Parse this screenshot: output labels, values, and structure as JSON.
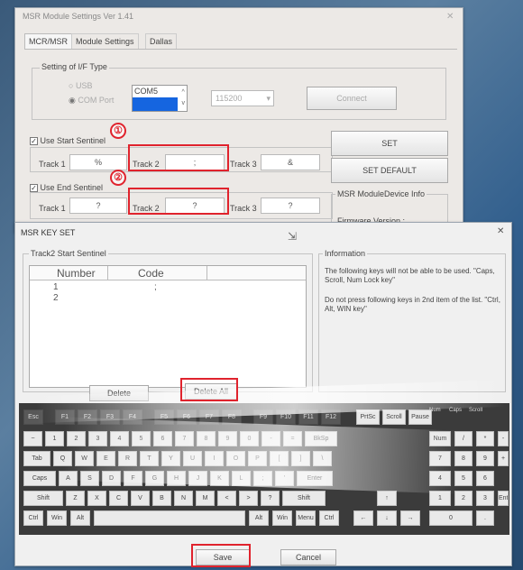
{
  "settings_window": {
    "title": "MSR Module Settings Ver 1.41",
    "tabs": [
      "MCR/MSR",
      "Module Settings",
      "Dallas"
    ],
    "if_group": {
      "title": "Setting of I/F Type",
      "radio_usb": "USB",
      "radio_com": "COM Port",
      "com_list": [
        "COM5",
        ""
      ],
      "baud": "115200",
      "connect": "Connect"
    },
    "start_sentinel": {
      "checkbox": "Use Start Sentinel",
      "track1_label": "Track 1",
      "track1_value": "%",
      "track2_label": "Track 2",
      "track2_value": ";",
      "track3_label": "Track 3",
      "track3_value": "&"
    },
    "end_sentinel": {
      "checkbox": "Use End Sentinel",
      "track1_label": "Track 1",
      "track1_value": "?",
      "track2_label": "Track 2",
      "track2_value": "?",
      "track3_label": "Track 3",
      "track3_value": "?"
    },
    "set_button": "SET",
    "set_default_button": "SET DEFAULT",
    "info_group_title": "MSR ModuleDevice Info",
    "firmware_label": "Firmware Version :"
  },
  "markers": {
    "one": "①",
    "two": "②"
  },
  "key_dialog": {
    "title": "MSR KEY SET",
    "close": "✕",
    "group_title": "Track2 Start Sentinel",
    "columns": [
      "Number",
      "Code"
    ],
    "rows": [
      {
        "number": "1",
        "code": ";"
      },
      {
        "number": "2",
        "code": ""
      }
    ],
    "info_title": "Information",
    "info_text_1": "The following keys will not be able to be used. \"Caps, Scroll, Num Lock key\"",
    "info_text_2": "Do not press following keys in 2nd item of the list. \"Ctrl, Alt, WIN key\"",
    "delete": "Delete",
    "delete_all": "Delete All",
    "save": "Save",
    "cancel": "Cancel"
  },
  "keyboard": {
    "row_fn": [
      "Esc",
      "F1",
      "F2",
      "F3",
      "F4",
      "F5",
      "F6",
      "F7",
      "F8",
      "F9",
      "F10",
      "F11",
      "F12",
      "PrtSc",
      "Scroll",
      "Pause"
    ],
    "indicators": [
      "Num",
      "Caps",
      "Scroll"
    ],
    "row_num": [
      "~",
      "1",
      "2",
      "3",
      "4",
      "5",
      "6",
      "7",
      "8",
      "9",
      "0",
      "-",
      "=",
      "BkSp"
    ],
    "row_tab": [
      "Tab",
      "Q",
      "W",
      "E",
      "R",
      "T",
      "Y",
      "U",
      "I",
      "O",
      "P",
      "[",
      "]",
      "\\"
    ],
    "row_caps": [
      "Caps",
      "A",
      "S",
      "D",
      "F",
      "G",
      "H",
      "J",
      "K",
      "L",
      ";",
      "'",
      "Enter"
    ],
    "row_shift": [
      "Shift",
      "Z",
      "X",
      "C",
      "V",
      "B",
      "N",
      "M",
      "<",
      ">",
      "?",
      "Shift"
    ],
    "row_ctrl": [
      "Ctrl",
      "Win",
      "Alt",
      "Alt",
      "Win",
      "Menu",
      "Ctrl"
    ],
    "arrows": [
      "↑",
      "←",
      "↓",
      "→"
    ],
    "numpad": [
      "Num Lock",
      "/",
      "*",
      "-",
      "7",
      "8",
      "9",
      "+",
      "4",
      "5",
      "6",
      "1",
      "2",
      "3",
      "Enter",
      "0",
      "."
    ]
  },
  "colors": {
    "highlight": "#e0232d",
    "selection": "#1565e0"
  }
}
